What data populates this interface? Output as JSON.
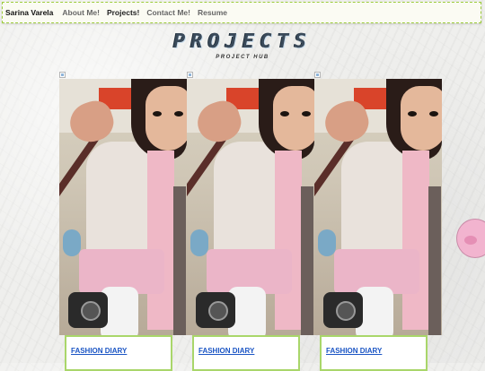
{
  "nav": {
    "brand": "Sarina Varela",
    "items": [
      "About Me!",
      "Projects!",
      "Contact Me!",
      "Resume"
    ],
    "active_index": 1
  },
  "header": {
    "title": "PROJECTS",
    "subtitle": "PROJECT HUB"
  },
  "cards": [
    {
      "caption": "FASHION DIARY"
    },
    {
      "caption": "FASHION DIARY"
    },
    {
      "caption": "FASHION DIARY"
    }
  ],
  "colors": {
    "nav_border": "#9ccc3a",
    "caption_border": "#a9d66a",
    "link": "#1b55c4"
  },
  "icons": [
    "broken-image-icon",
    "pig-sticker-icon"
  ]
}
